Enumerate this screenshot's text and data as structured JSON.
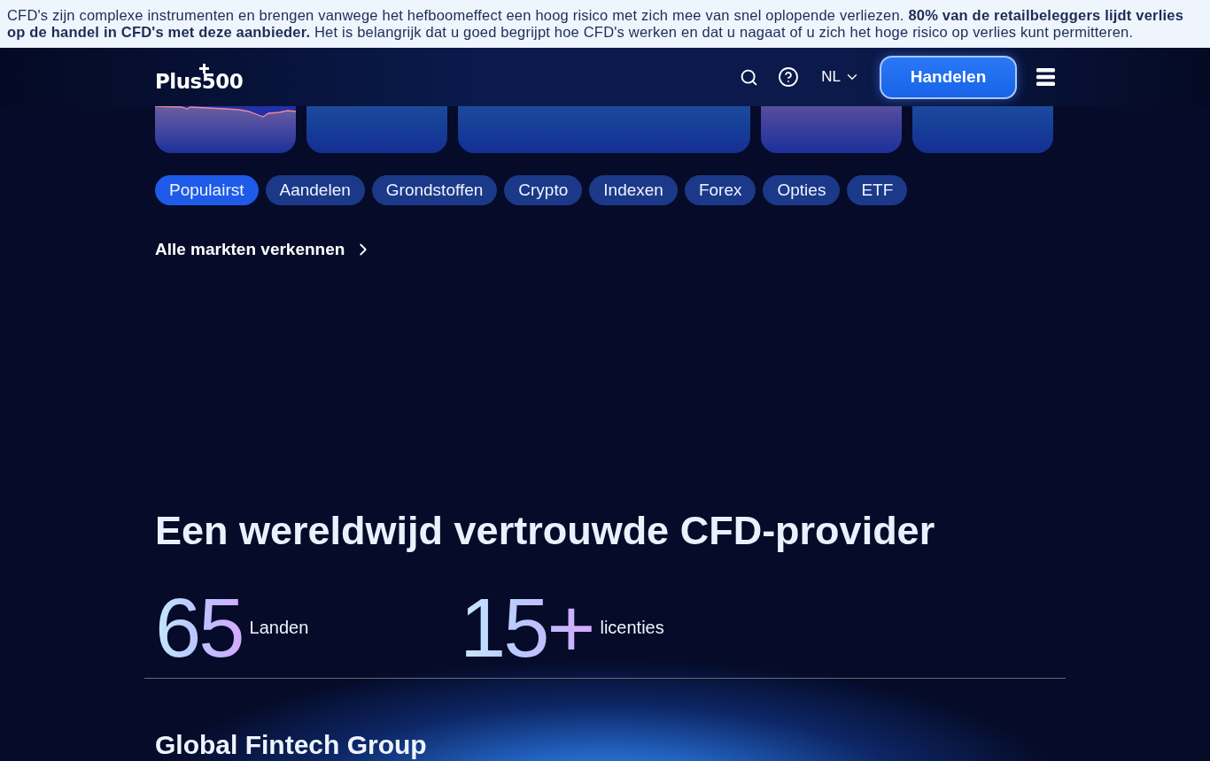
{
  "risk_banner": {
    "text": "CFD's zijn complexe instrumenten en brengen vanwege het hefboomeffect een hoog risico met zich mee van snel oplopende verliezen. **80% van de retailbeleggers lijdt verlies op de handel in CFD's met deze aanbieder.** Het is belangrijk dat u goed begrijpt hoe CFD's werken en dat u nagaat of u zich het hoge risico op verlies kunt permitteren."
  },
  "header": {
    "logo": "Plus500",
    "language": "NL",
    "cta_button": "Handelen"
  },
  "market_cards": [
    {
      "kind": "chart"
    },
    {
      "kind": "plain"
    },
    {
      "kind": "wide"
    },
    {
      "kind": "tinted"
    },
    {
      "kind": "plain"
    }
  ],
  "market_tabs": [
    {
      "label": "Populairst",
      "selected": true
    },
    {
      "label": "Aandelen",
      "selected": false
    },
    {
      "label": "Grondstoffen",
      "selected": false
    },
    {
      "label": "Crypto",
      "selected": false
    },
    {
      "label": "Indexen",
      "selected": false
    },
    {
      "label": "Forex",
      "selected": false
    },
    {
      "label": "Opties",
      "selected": false
    },
    {
      "label": "ETF",
      "selected": false
    }
  ],
  "explore_link": "Alle markten verkennen",
  "trust_section": {
    "title": "Een wereldwijd vertrouwde CFD-provider",
    "stats": [
      {
        "value": "65",
        "label": "Landen"
      },
      {
        "value": "15+",
        "label": "licenties"
      }
    ]
  },
  "group_section": {
    "title": "Global Fintech Group"
  }
}
